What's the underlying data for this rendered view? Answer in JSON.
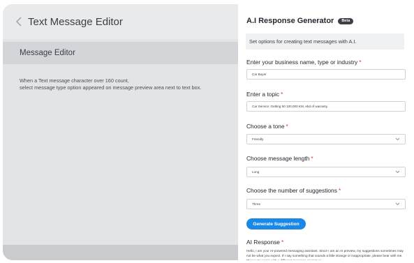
{
  "editor": {
    "title": "Text Message Editor",
    "section_title": "Message Editor",
    "hint_line1": "When a Text message character over 160 count,",
    "hint_line2": "select message type option appeared on message preview area next to text box."
  },
  "panel": {
    "title": "A.I Response Generator",
    "badge": "Beta",
    "info": "Set options for creating text messages with A.I.",
    "business": {
      "label": "Enter your business name, type or industry",
      "required": "*",
      "value": "Car Buyer"
    },
    "topic": {
      "label": "Enter a topic",
      "required": "*",
      "value": "Car Service: Getting 50 100,000 KM, ebd of warranty."
    },
    "tone": {
      "label": "Choose a tone",
      "required": "*",
      "value": "Friendly"
    },
    "length": {
      "label": "Choose message length",
      "required": "*",
      "value": "Long"
    },
    "suggestions": {
      "label": "Choose the number of suggestions",
      "required": "*",
      "value": "Three"
    },
    "generate_label": "Generate Suggestion",
    "response": {
      "label": "AI Response",
      "required": "*",
      "text": "Hello, I am your AI-powered messaging assistant. Since I am an AI preview, my suggestions sometimes may not be what you expect. If I say something that sounds a little strange or inappropriate, please bear with me. Please try again with a different message prompt or"
    }
  },
  "colors": {
    "accent": "#1a88e6",
    "required": "#e53935",
    "badge": "#3b3f46"
  },
  "icons": {
    "back": "chevron-left-icon",
    "dropdown": "chevron-down-icon"
  }
}
